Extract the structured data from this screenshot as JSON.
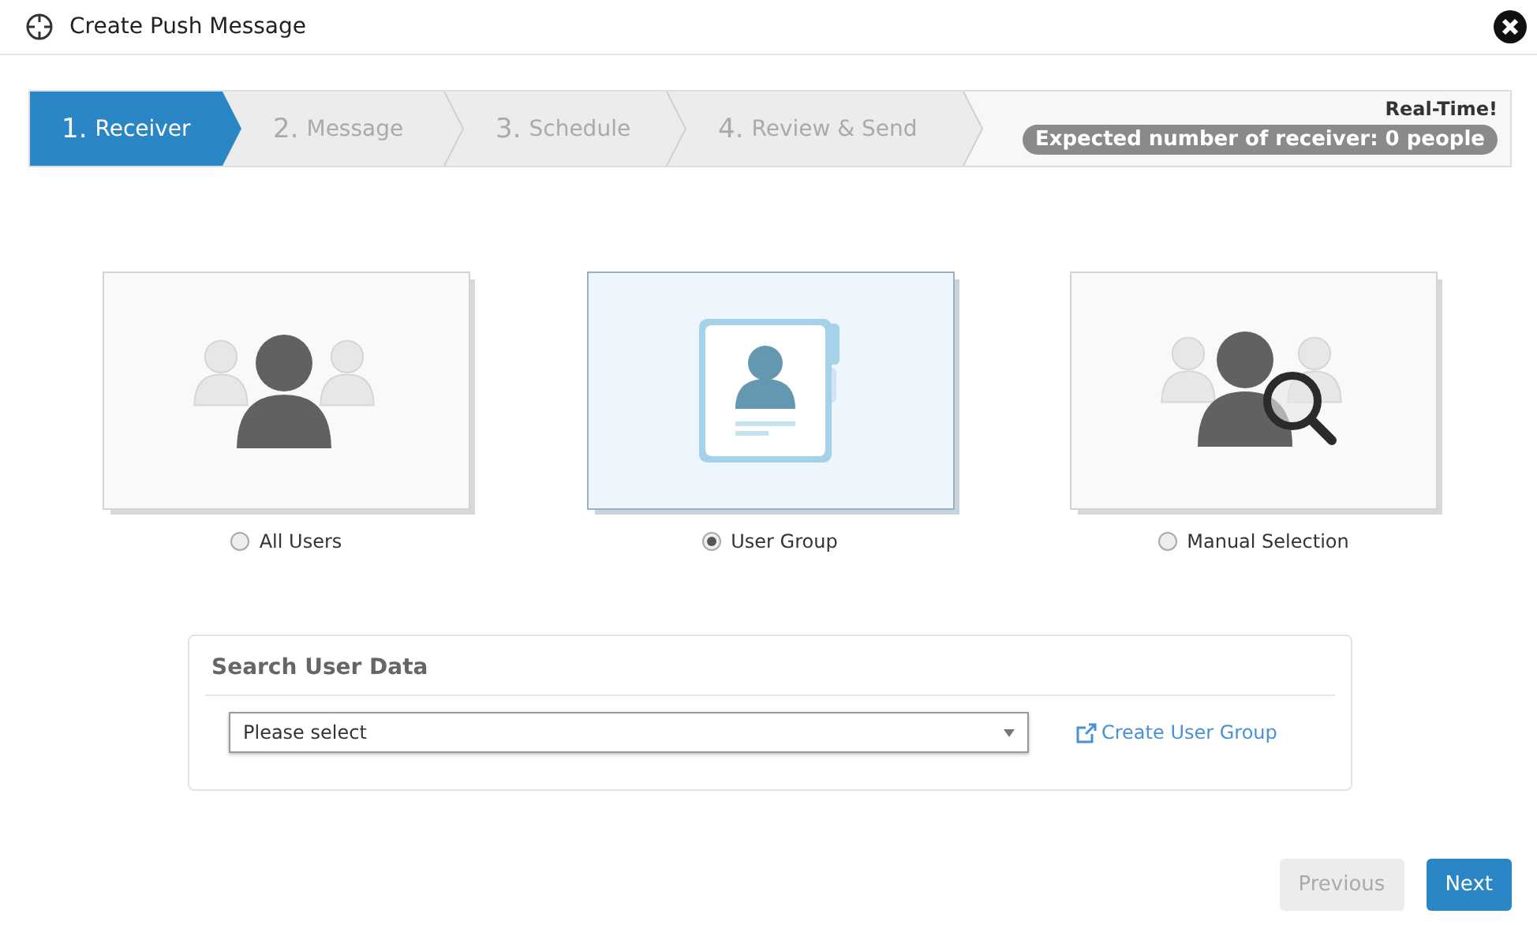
{
  "window": {
    "title": "Create Push Message"
  },
  "steps": [
    {
      "number": "1.",
      "label": "Receiver",
      "selected": true
    },
    {
      "number": "2.",
      "label": "Message",
      "selected": false
    },
    {
      "number": "3.",
      "label": "Schedule",
      "selected": false
    },
    {
      "number": "4.",
      "label": "Review & Send",
      "selected": false
    }
  ],
  "realtime": {
    "label": "Real-Time!",
    "count": "Expected number of receiver: 0 people"
  },
  "receivers": [
    {
      "kind": "all",
      "label": "All Users",
      "selected": false
    },
    {
      "kind": "group",
      "label": "User Group",
      "selected": true
    },
    {
      "kind": "manual",
      "label": "Manual Selection",
      "selected": false
    }
  ],
  "search_panel": {
    "title": "Search User Data",
    "select": {
      "placeholder": "Please select"
    },
    "link": "Create User Group"
  },
  "buttons": [
    {
      "label": "Previous",
      "disabled": true
    },
    {
      "label": "Next",
      "disabled": false
    }
  ]
}
